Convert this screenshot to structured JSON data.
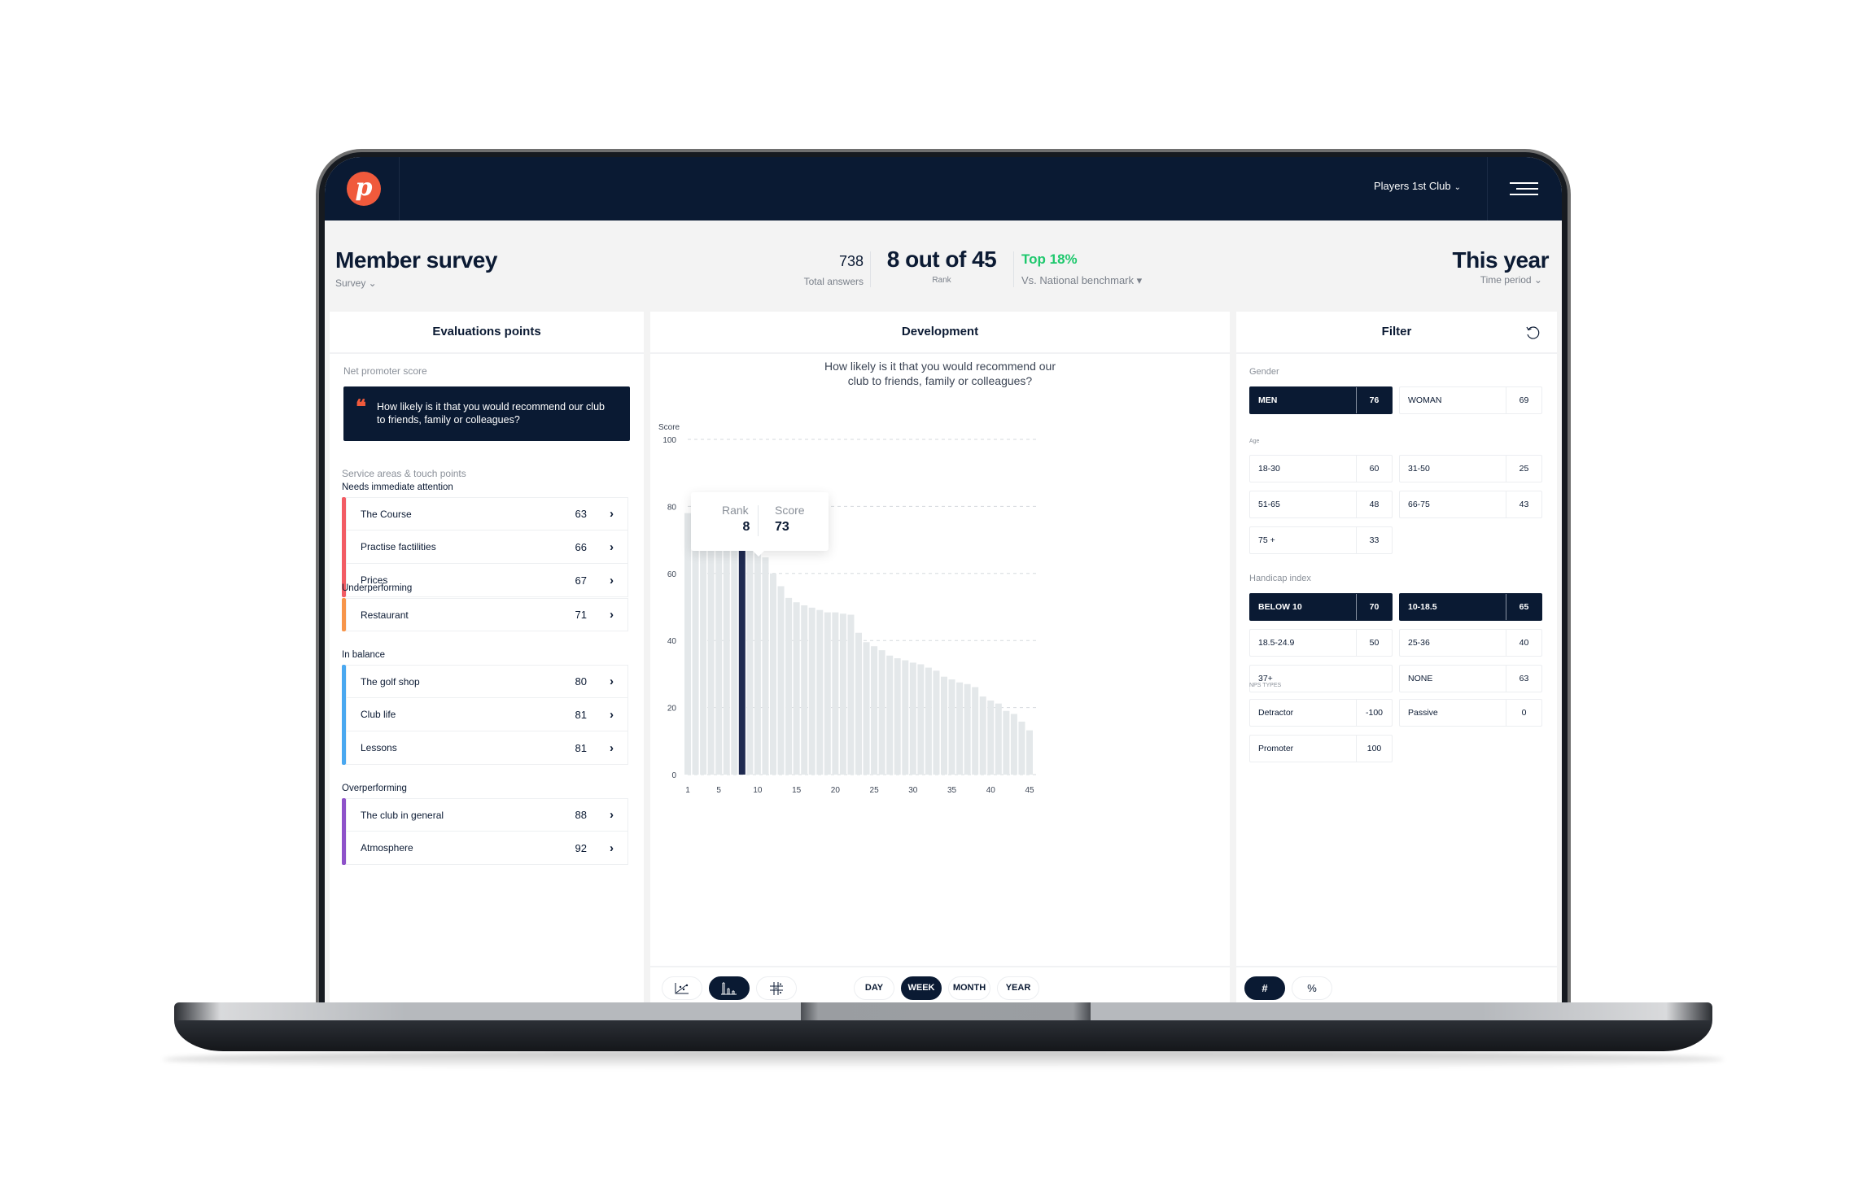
{
  "nav": {
    "logo_letter": "p",
    "club_name": "Players 1st Club",
    "club_chevron": "⌄"
  },
  "header": {
    "title": "Member survey",
    "survey_label": "Survey ⌄",
    "total_answers_value": "738",
    "total_answers_label": "Total answers",
    "rank_value": "8 out of 45",
    "rank_label": "Rank",
    "benchmark_value": "Top 18%",
    "benchmark_label": "Vs. National benchmark ▾",
    "period_value": "This year",
    "period_label": "Time period  ⌄"
  },
  "colors": {
    "navy": "#0a1a33",
    "accent_orange": "#f05a3c",
    "positive_green": "#1ec86d",
    "needs_attention": "#f25c64",
    "underperforming": "#f7954a",
    "in_balance": "#4aa8f0",
    "overperforming": "#8e52c9",
    "bar_default": "#e4e8ea",
    "bar_highlight": "#1f2a50"
  },
  "evaluations": {
    "title": "Evaluations points",
    "nps_label": "Net promoter score",
    "nps_quote_mark": "❝",
    "nps_question": "How likely is it that you would recommend our club to friends, family or colleagues?",
    "service_label": "Service areas & touch points",
    "groups": [
      {
        "label": "Needs immediate attention",
        "items": [
          {
            "name": "The Course",
            "score": "63"
          },
          {
            "name": "Practise factilities",
            "score": "66"
          },
          {
            "name": "Prices",
            "score": "67"
          }
        ]
      },
      {
        "label": "Underperforming",
        "items": [
          {
            "name": "Restaurant",
            "score": "71"
          }
        ]
      },
      {
        "label": "In balance",
        "items": [
          {
            "name": "The golf shop",
            "score": "80"
          },
          {
            "name": "Club life",
            "score": "81"
          },
          {
            "name": "Lessons",
            "score": "81"
          }
        ]
      },
      {
        "label": "Overperforming",
        "items": [
          {
            "name": "The club in general",
            "score": "88"
          },
          {
            "name": "Atmosphere",
            "score": "92"
          }
        ]
      }
    ],
    "arrow": "›"
  },
  "development": {
    "title": "Development",
    "question_line1": "How likely is it that you would recommend our",
    "question_line2": "club to friends, family or colleagues?",
    "tooltip": {
      "rank_label": "Rank",
      "rank_value": "8",
      "score_label": "Score",
      "score_value": "73"
    },
    "chart_types": [
      "scatter-chart",
      "bar-chart",
      "matrix-chart"
    ],
    "active_chart_type": 1,
    "periods": [
      "DAY",
      "WEEK",
      "MONTH",
      "YEAR"
    ],
    "active_period": 1
  },
  "chart_data": {
    "type": "bar",
    "title": "How likely is it that you would recommend our club to friends, family or colleagues?",
    "xlabel": "",
    "ylabel": "Score",
    "ylim": [
      0,
      100
    ],
    "yticks": [
      0,
      20,
      40,
      60,
      80,
      100
    ],
    "xticks": [
      1,
      5,
      10,
      15,
      20,
      25,
      30,
      35,
      40,
      45
    ],
    "grid": true,
    "highlight_index": 8,
    "x": [
      1,
      2,
      3,
      4,
      5,
      6,
      7,
      8,
      9,
      10,
      11,
      12,
      13,
      14,
      15,
      16,
      17,
      18,
      19,
      20,
      21,
      22,
      23,
      24,
      25,
      26,
      27,
      28,
      29,
      30,
      31,
      32,
      33,
      34,
      35,
      36,
      37,
      38,
      39,
      40,
      41,
      42,
      43,
      44,
      45
    ],
    "values": [
      78,
      77,
      76,
      75,
      74,
      73.5,
      73,
      73,
      71.4,
      68.2,
      64.8,
      60,
      56.2,
      52.7,
      51.4,
      50.5,
      49.8,
      49.1,
      48.4,
      48.4,
      48,
      47.7,
      42.3,
      39.5,
      38.3,
      37.1,
      35.5,
      34.7,
      34.1,
      33.4,
      32.9,
      31.9,
      31,
      29.2,
      28.4,
      27.5,
      27,
      26.1,
      23.3,
      22.1,
      21.2,
      19,
      18.1,
      15.8,
      13.2
    ]
  },
  "filter": {
    "title": "Filter",
    "sections": [
      {
        "label": "Gender",
        "chips": [
          {
            "label": "MEN",
            "value": "76",
            "active": true
          },
          {
            "label": "WOMAN",
            "value": "69",
            "active": false
          }
        ]
      },
      {
        "label": "Age",
        "chips": [
          {
            "label": "18-30",
            "value": "60",
            "active": false
          },
          {
            "label": "31-50",
            "value": "25",
            "active": false
          },
          {
            "label": "51-65",
            "value": "48",
            "active": false
          },
          {
            "label": "66-75",
            "value": "43",
            "active": false
          },
          {
            "label": "75 +",
            "value": "33",
            "active": false
          }
        ]
      },
      {
        "label": "Handicap index",
        "chips": [
          {
            "label": "BELOW 10",
            "value": "70",
            "active": true
          },
          {
            "label": "10-18.5",
            "value": "65",
            "active": true
          },
          {
            "label": "18.5-24.9",
            "value": "50",
            "active": false
          },
          {
            "label": "25-36",
            "value": "40",
            "active": false
          },
          {
            "label": "37+",
            "value": "",
            "active": false
          },
          {
            "label": "NONE",
            "value": "63",
            "active": false
          }
        ]
      },
      {
        "label": "NPS TYPES",
        "chips": [
          {
            "label": "Detractor",
            "value": "-100",
            "active": false
          },
          {
            "label": "Passive",
            "value": "0",
            "active": false
          },
          {
            "label": "Promoter",
            "value": "100",
            "active": false
          }
        ]
      }
    ],
    "units": [
      "#",
      "%"
    ],
    "active_unit": 0
  }
}
